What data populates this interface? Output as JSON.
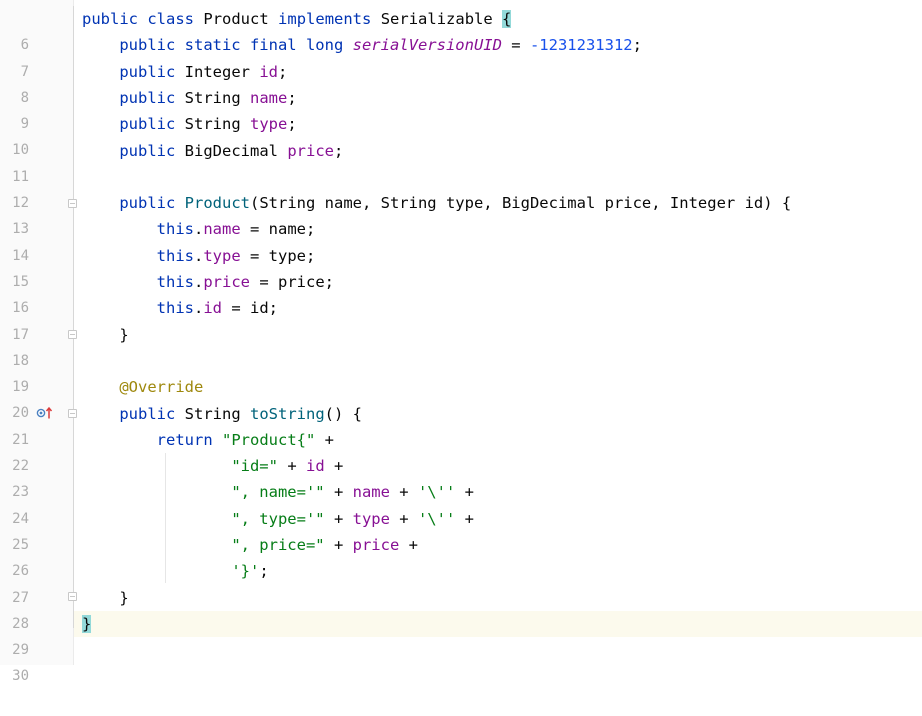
{
  "editor": {
    "line_numbers": [
      "6",
      "7",
      "8",
      "9",
      "10",
      "11",
      "12",
      "13",
      "14",
      "15",
      "16",
      "17",
      "18",
      "19",
      "20",
      "21",
      "22",
      "23",
      "24",
      "25",
      "26",
      "27",
      "28",
      "29",
      "30"
    ],
    "code": {
      "l6": {
        "kw_public": "public",
        "kw_class": "class",
        "class_name": "Product",
        "kw_implements": "implements",
        "iface": "Serializable",
        "brace": "{"
      },
      "l7": {
        "mods": "public static final long",
        "field": "serialVersionUID",
        "eq": " = ",
        "value": "-1231231312",
        "semi": ";"
      },
      "l8": {
        "kw": "public",
        "type": "Integer",
        "field": "id",
        "semi": ";"
      },
      "l9": {
        "kw": "public",
        "type": "String",
        "field": "name",
        "semi": ";"
      },
      "l10": {
        "kw": "public",
        "type": "String",
        "field": "type",
        "semi": ";"
      },
      "l11": {
        "kw": "public",
        "type": "BigDecimal",
        "field": "price",
        "semi": ";"
      },
      "l13": {
        "kw": "public",
        "ctor": "Product",
        "params": "(String name, String type, BigDecimal price, Integer id) {"
      },
      "l14": {
        "kw": "this",
        "field": "name",
        "rest": " = name;"
      },
      "l15": {
        "kw": "this",
        "field": "type",
        "rest": " = type;"
      },
      "l16": {
        "kw": "this",
        "field": "price",
        "rest": " = price;"
      },
      "l17": {
        "kw": "this",
        "field": "id",
        "rest": " = id;"
      },
      "l18": {
        "text": "}"
      },
      "l20": {
        "annotation": "@Override"
      },
      "l21": {
        "kw": "public",
        "type": "String",
        "method": "toString",
        "rest": "() {"
      },
      "l22": {
        "kw": "return",
        "str": "\"Product{\"",
        "rest": " +"
      },
      "l23": {
        "str": "\"id=\"",
        "op": " + ",
        "field": "id",
        "rest": " +"
      },
      "l24": {
        "str": "\", name='\"",
        "op": " + ",
        "field": "name",
        "op2": " + ",
        "str2": "'\\''",
        "rest": " +"
      },
      "l25": {
        "str": "\", type='\"",
        "op": " + ",
        "field": "type",
        "op2": " + ",
        "str2": "'\\''",
        "rest": " +"
      },
      "l26": {
        "str": "\", price=\"",
        "op": " + ",
        "field": "price",
        "rest": " +"
      },
      "l27": {
        "str": "'}'",
        "rest": ";"
      },
      "l28": {
        "text": "}"
      },
      "l29": {
        "text": "}"
      }
    },
    "gutter_markers": {
      "override_icon": "overrides-method-icon"
    },
    "colors": {
      "keyword": "#0033b3",
      "field": "#871094",
      "number": "#1750eb",
      "string": "#067d17",
      "annotation": "#9e880d",
      "method": "#00627a",
      "current_line": "#fcfaed",
      "brace_match": "#93d9d9"
    }
  }
}
